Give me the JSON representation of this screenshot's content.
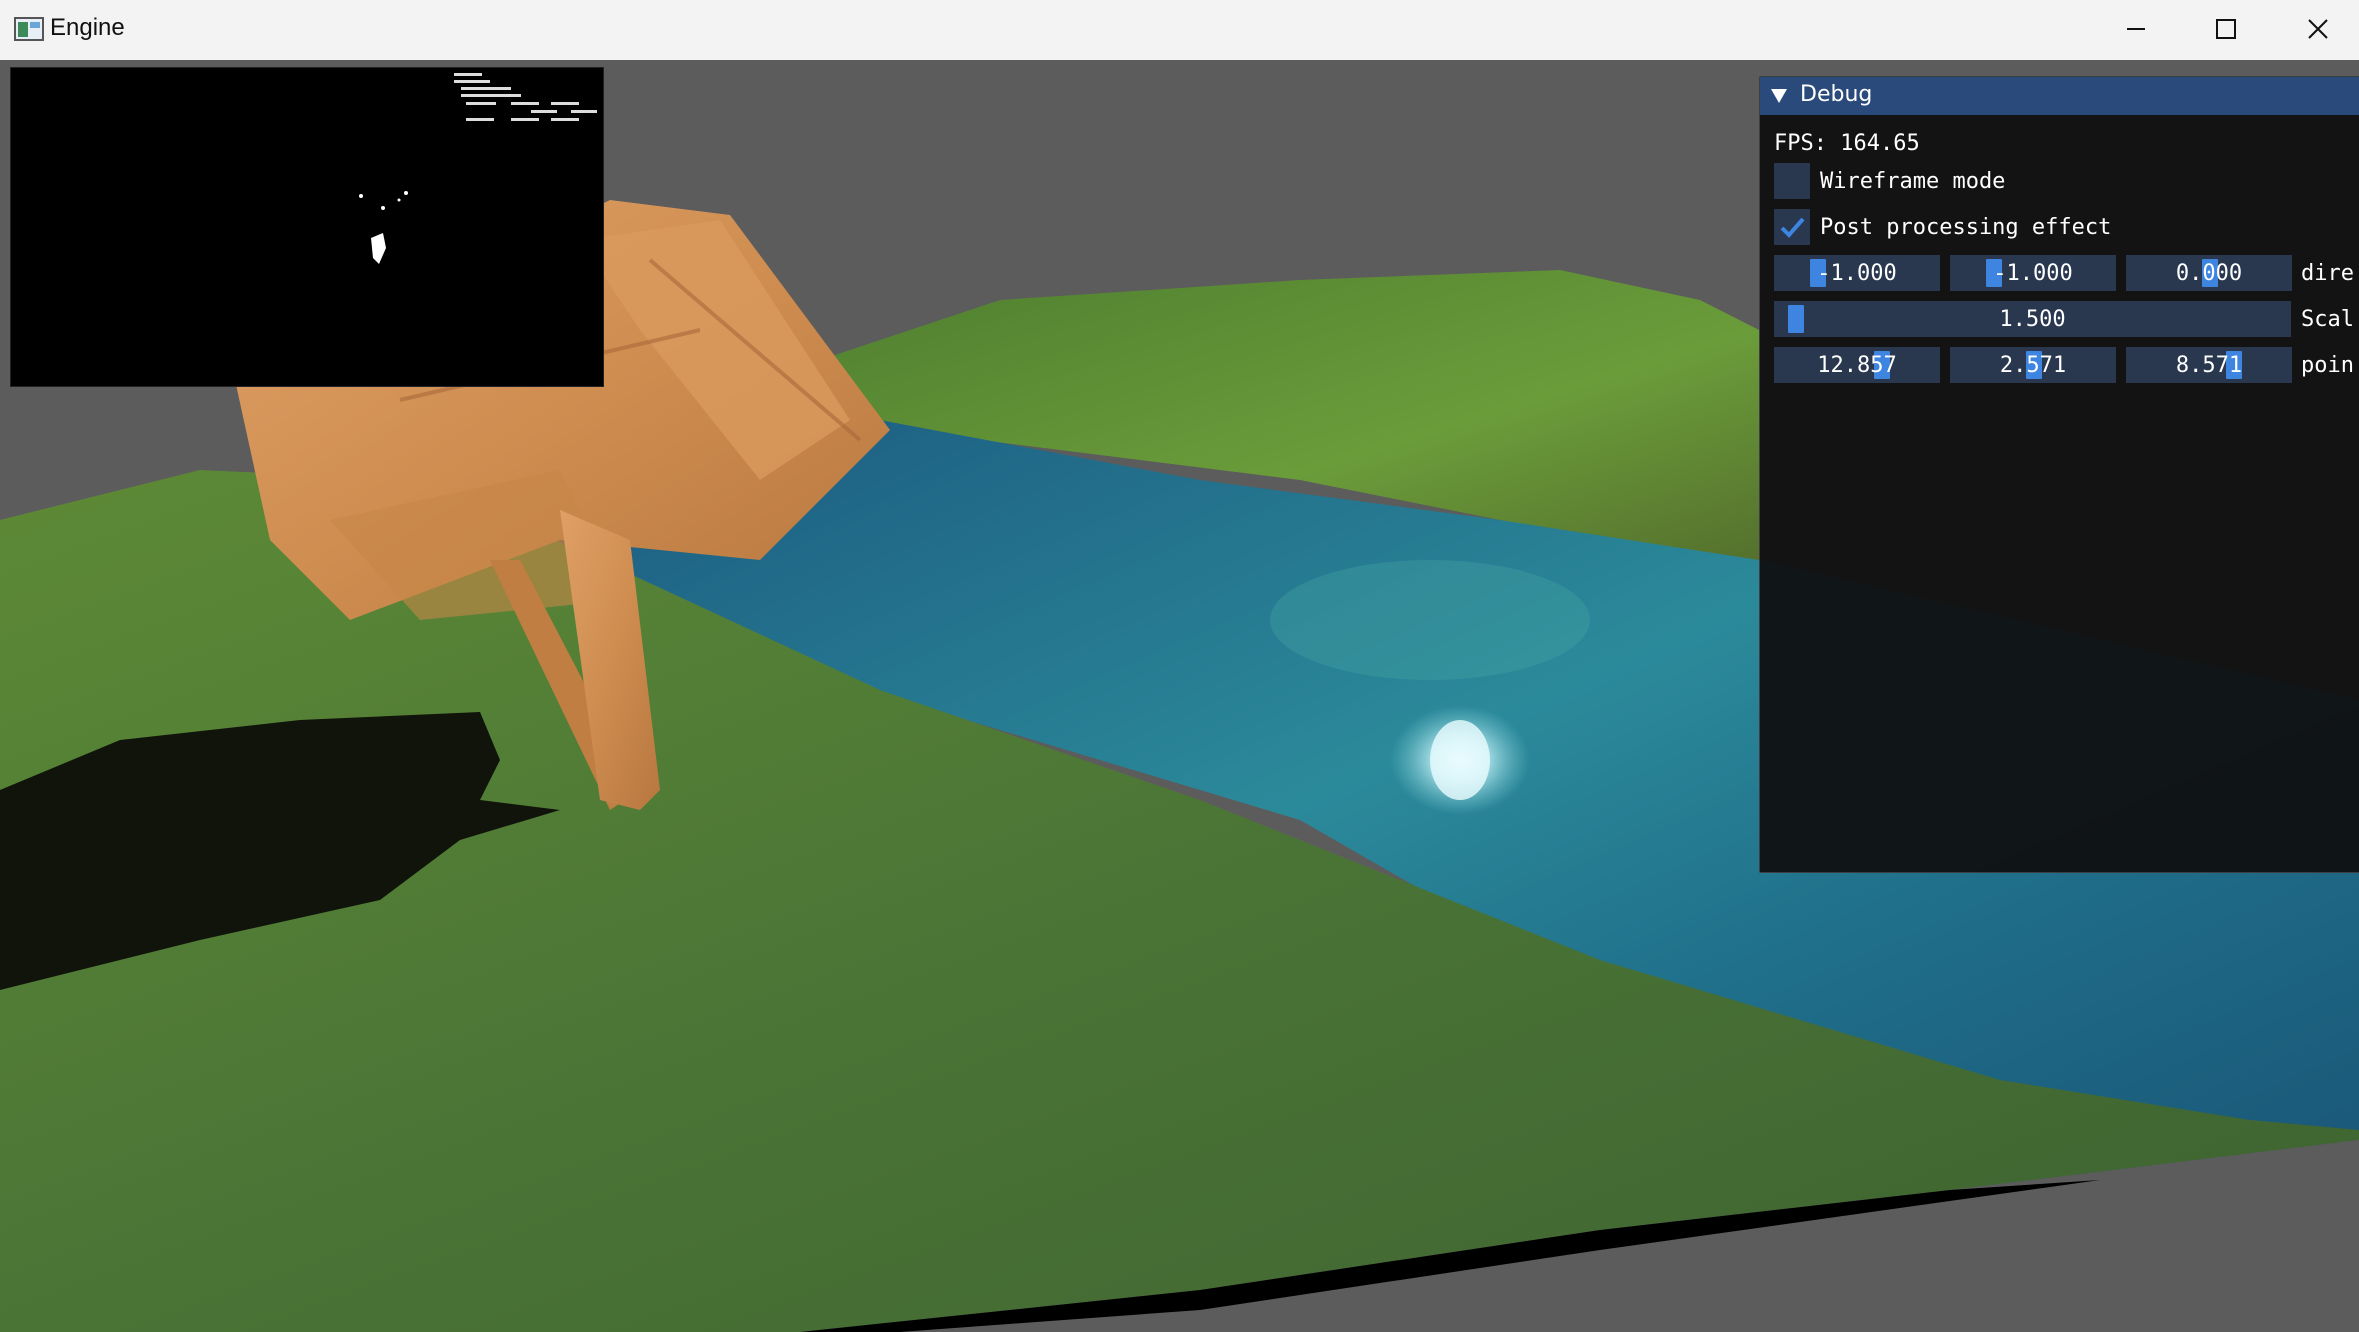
{
  "window": {
    "title": "Engine",
    "icons": {
      "app": "app-window-icon",
      "minimize": "minimize-icon",
      "maximize": "maximize-icon",
      "close": "close-icon"
    }
  },
  "debug": {
    "title": "Debug",
    "fps": "FPS: 164.65",
    "wireframe": {
      "label": "Wireframe mode",
      "checked": false
    },
    "post_processing": {
      "label": "Post processing effect",
      "checked": true
    },
    "direction": {
      "values": [
        "-1.000",
        "-1.000",
        "0.000"
      ],
      "label": "dire"
    },
    "scale": {
      "value": "1.500",
      "label": "Scal"
    },
    "point": {
      "values": [
        "12.857",
        "2.571",
        "8.571"
      ],
      "label": "poin"
    }
  },
  "colors": {
    "accent": "#3d85e0",
    "header": "#294a7a",
    "frame_bg": "#29374f",
    "window_bg": "#0f0f10",
    "background": "#5c5c5c"
  }
}
